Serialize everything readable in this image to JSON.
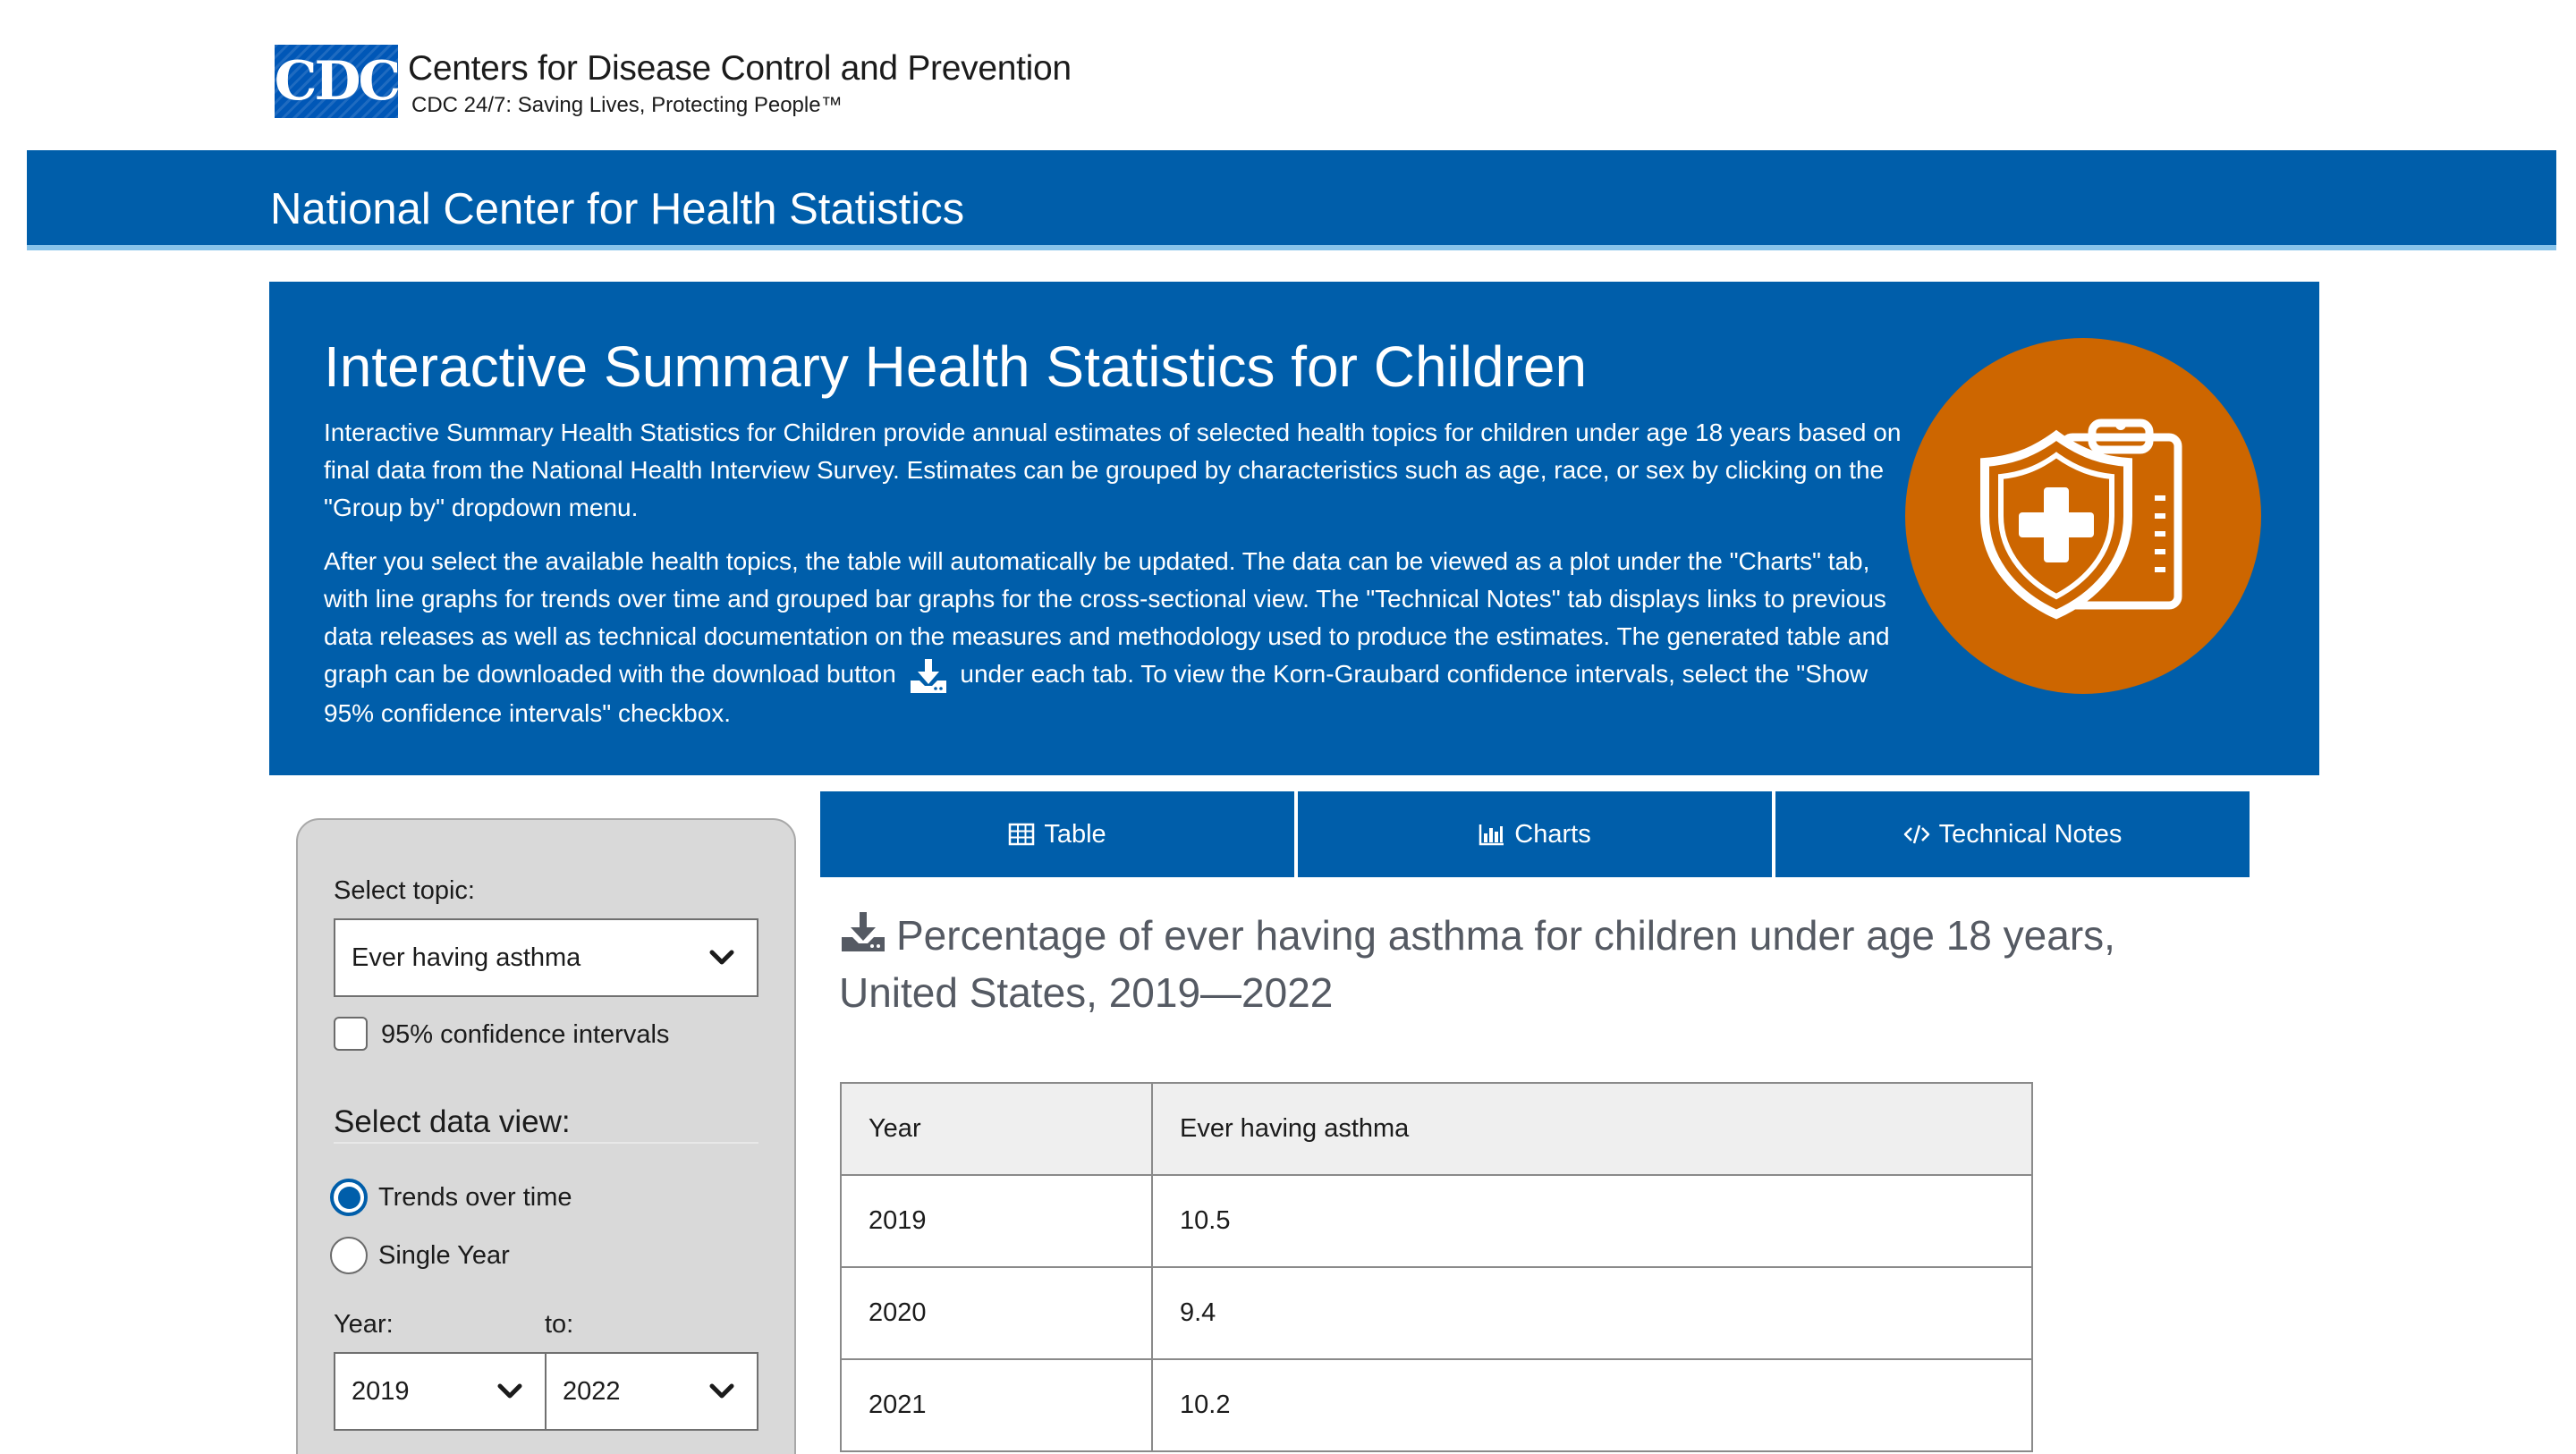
{
  "header": {
    "logo_text": "CDC",
    "org_name": "Centers for Disease Control and Prevention",
    "tagline": "CDC 24/7: Saving Lives, Protecting People™",
    "center_name": "National Center for Health Statistics"
  },
  "hero": {
    "title": "Interactive Summary Health Statistics for Children",
    "paragraph1": "Interactive Summary Health Statistics for Children provide annual estimates of selected health topics for children under age 18 years based on final data from the National Health Interview Survey. Estimates can be grouped by characteristics such as age, race, or sex by clicking on the \"Group by\" dropdown menu.",
    "paragraph2_before_icon": "After you select the available health topics, the table will automatically be updated. The data can be viewed as a plot under the \"Charts\" tab, with line graphs for trends over time and grouped bar graphs for the cross-sectional view. The \"Technical Notes\" tab displays links to previous data releases as well as technical documentation on the measures and methodology used to produce the estimates. The generated table and graph can be downloaded with the download button",
    "paragraph2_after_icon": "under each tab. To view the Korn-Graubard confidence intervals, select the \"Show 95% confidence intervals\" checkbox.",
    "emblem_icon": "shield-clipboard-medical-icon"
  },
  "sidebar": {
    "topic_label": "Select topic:",
    "topic_value": "Ever having asthma",
    "ci_label": "95% confidence intervals",
    "ci_checked": false,
    "data_view_label": "Select data view:",
    "data_view_options": [
      {
        "label": "Trends over time",
        "selected": true
      },
      {
        "label": "Single Year",
        "selected": false
      }
    ],
    "year_label": "Year:",
    "to_label": "to:",
    "year_from": "2019",
    "year_to": "2022"
  },
  "tabs": [
    {
      "label": "Table",
      "icon": "table-icon"
    },
    {
      "label": "Charts",
      "icon": "bar-chart-icon"
    },
    {
      "label": "Technical Notes",
      "icon": "code-icon"
    }
  ],
  "main": {
    "title": "Percentage of ever having asthma for children under age 18 years, United States, 2019—2022",
    "table": {
      "columns": [
        "Year",
        "Ever having asthma"
      ],
      "rows": [
        [
          "2019",
          "10.5"
        ],
        [
          "2020",
          "9.4"
        ],
        [
          "2021",
          "10.2"
        ]
      ]
    }
  },
  "colors": {
    "primary_blue": "#005eaa",
    "accent_light_blue": "#88c3ea",
    "emblem_orange": "#cd6600",
    "sidebar_gray": "#d9d9d9"
  }
}
